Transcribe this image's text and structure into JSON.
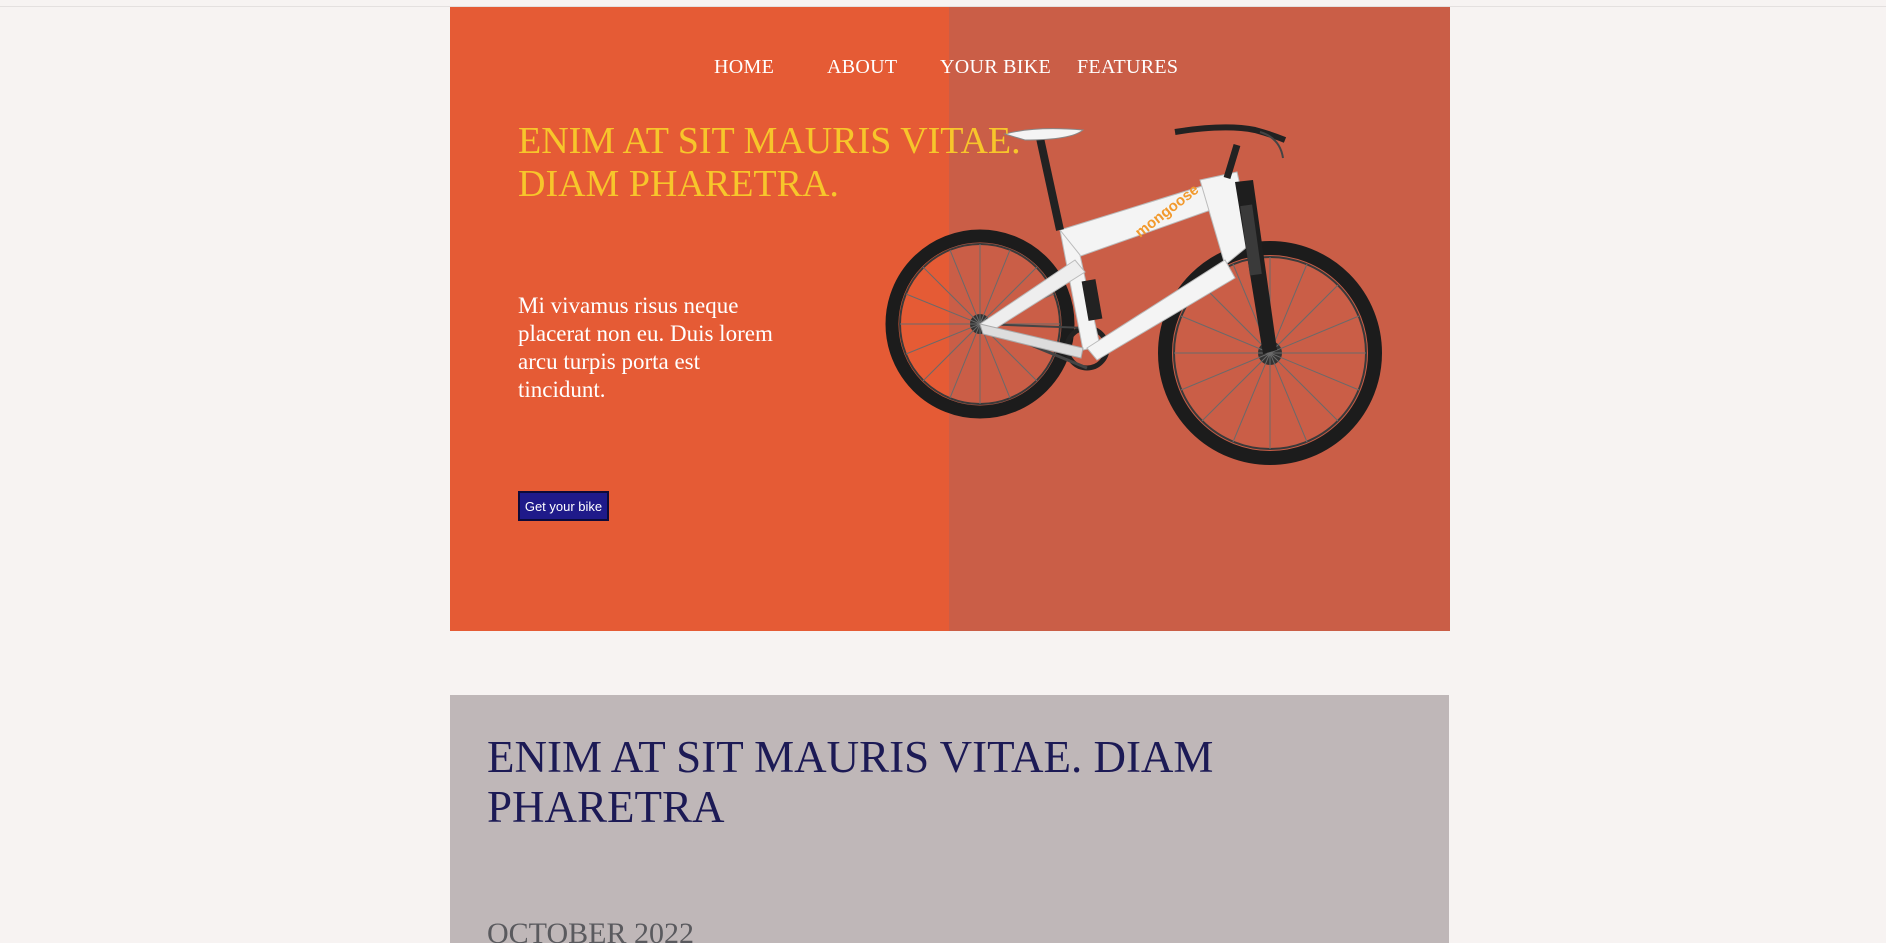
{
  "nav": {
    "items": [
      "HOME",
      "ABOUT",
      "YOUR BIKE",
      "FEATURES"
    ]
  },
  "hero": {
    "title": "ENIM AT SIT MAURIS VITAE. DIAM PHARETRA.",
    "text": "Mi vivamus risus neque placerat non eu. Duis lorem arcu turpis porta est tincidunt.",
    "button_label": "Get your bike",
    "image": "mountain-bike-image"
  },
  "section2": {
    "title": "ENIM AT SIT MAURIS VITAE. DIAM PHARETRA",
    "date": "OCTOBER 2022"
  },
  "colors": {
    "page_background": "#f7f3f2",
    "hero_left": "#e55b35",
    "hero_right": "#ca5e47",
    "hero_title": "#f7c62b",
    "button": "#1f1a8a",
    "section2_background": "#bfb7b8",
    "section2_title": "#1c1a55"
  }
}
